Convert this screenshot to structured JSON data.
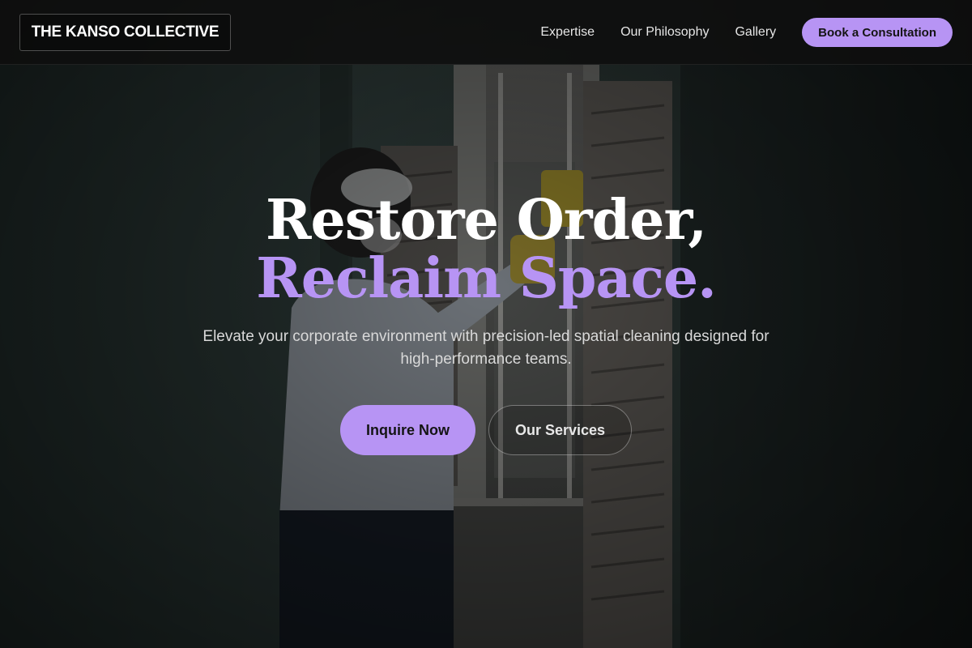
{
  "nav": {
    "brand": "THE KANSO COLLECTIVE",
    "links": [
      "Expertise",
      "Our Philosophy",
      "Gallery"
    ],
    "cta": "Book a Consultation"
  },
  "hero": {
    "headline_line1": "Restore Order,",
    "headline_line2": "Reclaim Space.",
    "subtitle": "Elevate your corporate environment with precision-led spatial cleaning designed for high-performance teams.",
    "primary_button": "Inquire Now",
    "secondary_button": "Our Services",
    "background_image": "person-cleaning-window-photo"
  },
  "colors": {
    "accent": "#b794f4",
    "navbar_bg": "#0e0e0e",
    "headline_white": "#ffffff",
    "wall_teal": "#2a3634"
  }
}
